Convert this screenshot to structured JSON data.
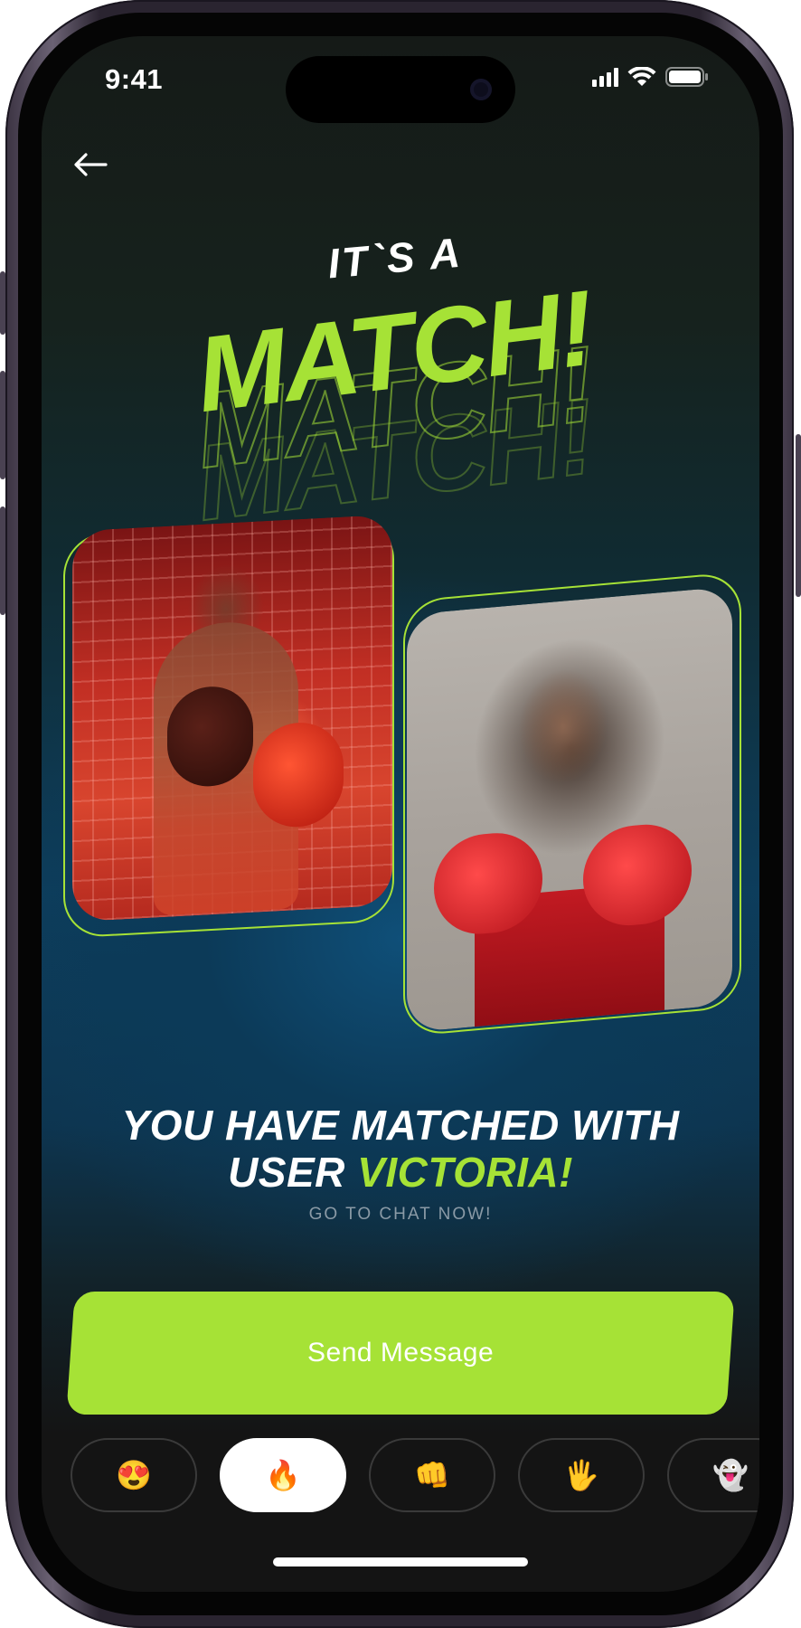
{
  "status_bar": {
    "time": "9:41"
  },
  "header": {
    "title_small": "IT`S A",
    "title_big": "MATCH!"
  },
  "match": {
    "message_line1": "YOU HAVE MATCHED WITH",
    "message_prefix": "USER",
    "matched_name": "VICTORIA!",
    "cta_sub": "GO TO CHAT NOW!"
  },
  "actions": {
    "send_label": "Send Message"
  },
  "reactions": [
    {
      "emoji": "😍",
      "icon": "heart-eyes-icon"
    },
    {
      "emoji": "🔥",
      "icon": "fire-icon",
      "selected": true
    },
    {
      "emoji": "👊",
      "icon": "fist-icon"
    },
    {
      "emoji": "🖐",
      "icon": "raised-hand-icon"
    },
    {
      "emoji": "👻",
      "icon": "ghost-icon"
    }
  ],
  "colors": {
    "accent": "#a6e236",
    "background_top": "#151a17",
    "background_mid": "#0d3e5d",
    "chip_border": "#3a3a3a"
  }
}
